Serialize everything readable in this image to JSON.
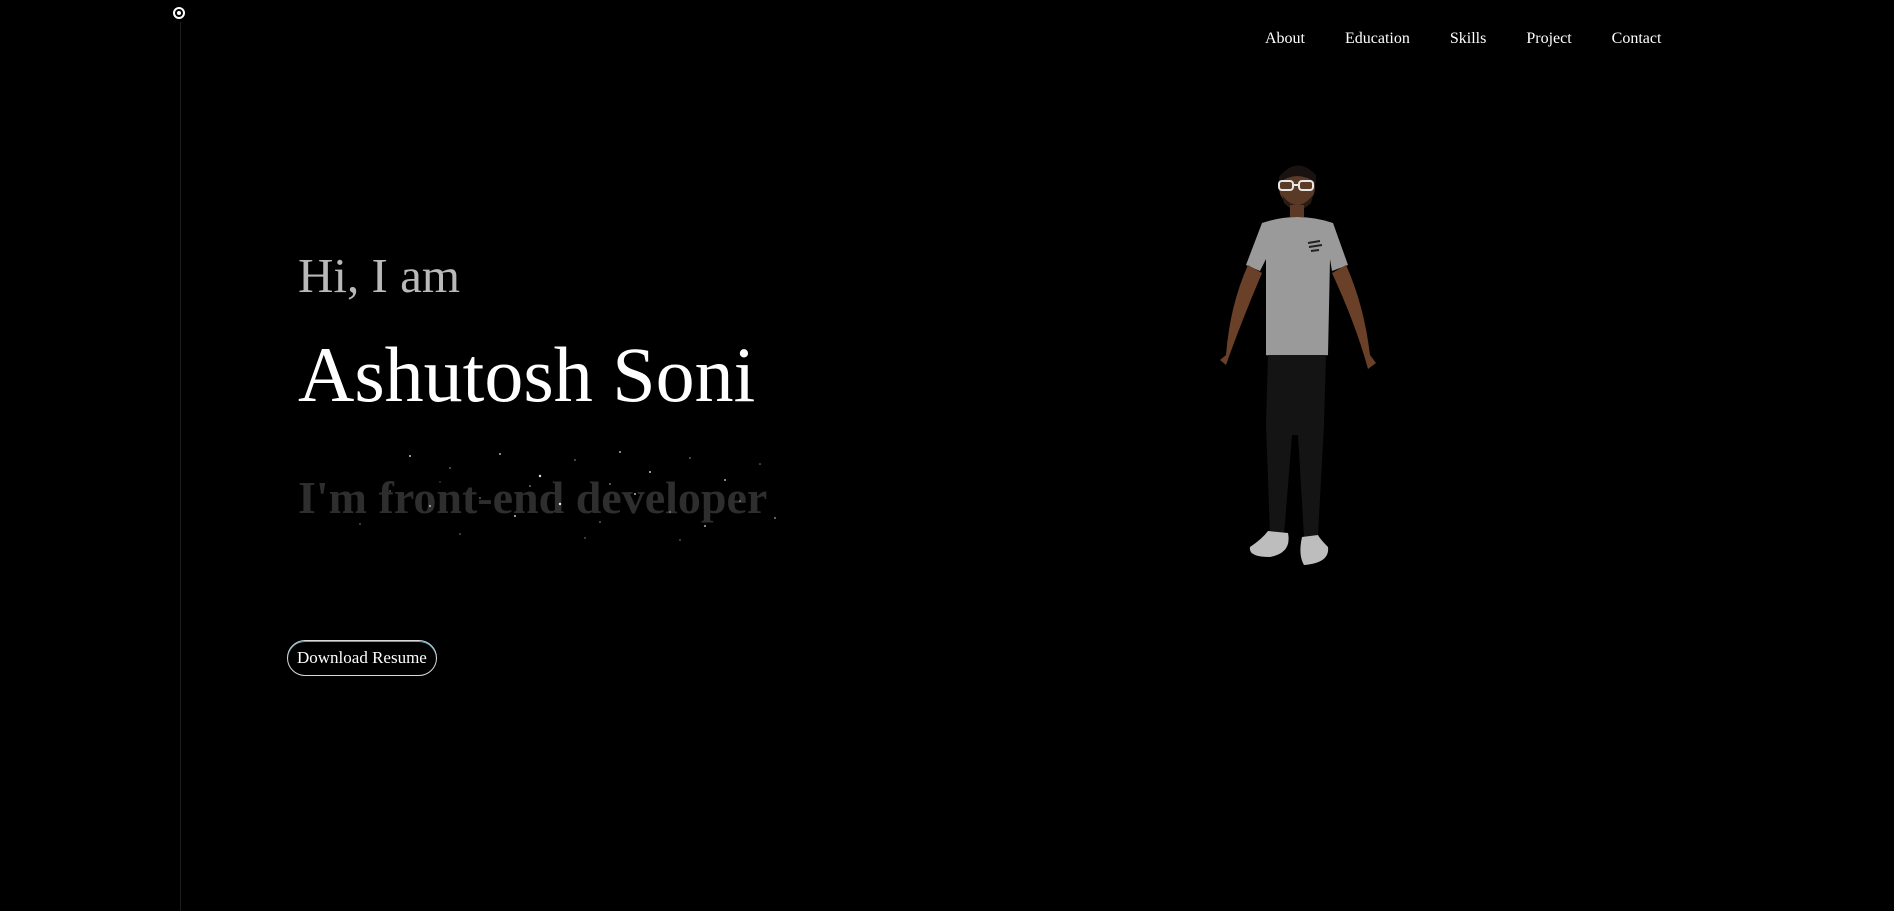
{
  "nav": {
    "items": [
      {
        "label": "About"
      },
      {
        "label": "Education"
      },
      {
        "label": "Skills"
      },
      {
        "label": "Project"
      },
      {
        "label": "Contact"
      }
    ]
  },
  "hero": {
    "greeting": "Hi, I am",
    "name": "Ashutosh Soni",
    "role": "I'm front-end developer",
    "resume_button": "Download Resume"
  },
  "avatar": {
    "icon": "3d-avatar-character",
    "shirt_print": "PLAY IT ON"
  },
  "colors": {
    "background": "#000000",
    "text": "#ffffff",
    "greeting": "#b9b9b9",
    "role": "#2e2e2e",
    "button_accent": "#5aa6c8"
  }
}
